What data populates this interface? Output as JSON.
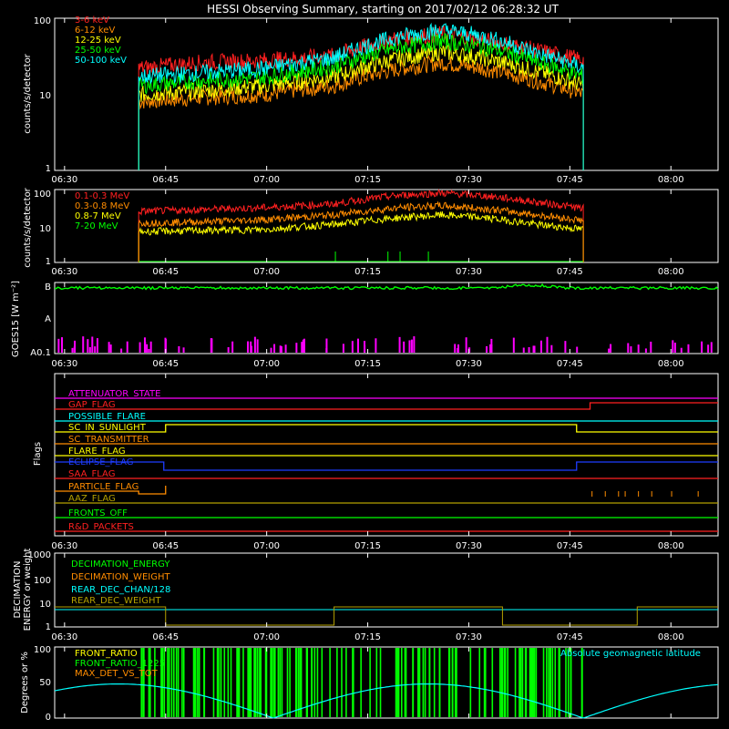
{
  "title": "HESSI Observing Summary, starting on 2017/02/12 06:28:32 UT",
  "colors": {
    "background": "#000000",
    "axes": "#ffffff",
    "red": "#ff2020",
    "orange": "#ff8c00",
    "yellow": "#ffff00",
    "green": "#00ff00",
    "cyan": "#00ffff",
    "magenta": "#ff00ff",
    "blue": "#1e3cff",
    "olive": "#b4a000"
  },
  "x_ticks": [
    "06:30",
    "06:45",
    "07:00",
    "07:15",
    "07:30",
    "07:45",
    "08:00"
  ],
  "chart_data": [
    {
      "type": "line",
      "id": "low-energy-rates",
      "ylabel": "counts/s/detector",
      "yscale": "log",
      "ylim": [
        1,
        100
      ],
      "y_ticks": [
        "1",
        "10",
        "100"
      ],
      "x_range": [
        "06:28:32",
        "08:07"
      ],
      "series": [
        {
          "name": "3-6 keV",
          "color": "red",
          "x": [
            "06:41",
            "06:50",
            "07:00",
            "07:10",
            "07:20",
            "07:26",
            "07:32",
            "07:40",
            "07:47"
          ],
          "values": [
            22,
            26,
            28,
            32,
            55,
            62,
            52,
            38,
            28
          ]
        },
        {
          "name": "6-12 keV",
          "color": "orange",
          "x": [
            "06:41",
            "06:50",
            "07:00",
            "07:10",
            "07:20",
            "07:26",
            "07:32",
            "07:40",
            "07:47"
          ],
          "values": [
            8,
            9,
            10,
            13,
            22,
            26,
            22,
            15,
            10
          ]
        },
        {
          "name": "12-25 keV",
          "color": "yellow",
          "x": [
            "06:41",
            "06:50",
            "07:00",
            "07:10",
            "07:20",
            "07:26",
            "07:32",
            "07:40",
            "07:47"
          ],
          "values": [
            10,
            11,
            13,
            17,
            30,
            36,
            30,
            20,
            13
          ]
        },
        {
          "name": "25-50 keV",
          "color": "green",
          "x": [
            "06:41",
            "06:50",
            "07:00",
            "07:10",
            "07:20",
            "07:26",
            "07:32",
            "07:40",
            "07:47"
          ],
          "values": [
            13,
            15,
            17,
            23,
            42,
            50,
            42,
            27,
            17
          ]
        },
        {
          "name": "50-100 keV",
          "color": "cyan",
          "x": [
            "06:41",
            "06:50",
            "07:00",
            "07:10",
            "07:20",
            "07:26",
            "07:32",
            "07:40",
            "07:47"
          ],
          "values": [
            17,
            19,
            22,
            30,
            58,
            70,
            58,
            35,
            22
          ]
        }
      ]
    },
    {
      "type": "line",
      "id": "high-energy-rates",
      "ylabel": "counts/s/detector",
      "yscale": "log",
      "ylim": [
        1,
        100
      ],
      "y_ticks": [
        "1",
        "10",
        "100"
      ],
      "series": [
        {
          "name": "0.1-0.3 MeV",
          "color": "red",
          "x": [
            "06:41",
            "06:50",
            "07:00",
            "07:10",
            "07:20",
            "07:26",
            "07:32",
            "07:40",
            "07:47"
          ],
          "values": [
            25,
            28,
            32,
            40,
            70,
            80,
            68,
            45,
            30
          ]
        },
        {
          "name": "0.3-0.8 MeV",
          "color": "orange",
          "x": [
            "06:41",
            "06:50",
            "07:00",
            "07:10",
            "07:20",
            "07:26",
            "07:32",
            "07:40",
            "07:47"
          ],
          "values": [
            12,
            13,
            15,
            20,
            32,
            36,
            30,
            20,
            14
          ]
        },
        {
          "name": "0.8-7 MeV",
          "color": "yellow",
          "x": [
            "06:41",
            "06:50",
            "07:00",
            "07:10",
            "07:20",
            "07:26",
            "07:32",
            "07:40",
            "07:47"
          ],
          "values": [
            7,
            7.5,
            8,
            11,
            17,
            20,
            17,
            11,
            8
          ]
        },
        {
          "name": "7-20 MeV",
          "color": "green",
          "x": [
            "06:41",
            "07:47"
          ],
          "values": [
            1,
            1
          ]
        }
      ]
    },
    {
      "type": "line",
      "id": "goes",
      "ylabel": "GOES15 [W m⁻²]",
      "y_ticks": [
        "A0.1",
        "A",
        "B"
      ],
      "series": [
        {
          "name": "GOES15",
          "color": "green",
          "x": [
            "06:30",
            "07:00",
            "07:30",
            "07:38",
            "07:46",
            "08:07"
          ],
          "values": [
            "B",
            "B",
            "B",
            "B+",
            "B",
            "B"
          ]
        }
      ]
    },
    {
      "type": "table",
      "id": "flags",
      "ylabel": "Flags",
      "rows": [
        {
          "name": "ATTENUATOR_STATE",
          "color": "magenta"
        },
        {
          "name": "GAP_FLAG",
          "color": "red"
        },
        {
          "name": "POSSIBLE_FLARE",
          "color": "cyan"
        },
        {
          "name": "SC_IN_SUNLIGHT",
          "color": "yellow"
        },
        {
          "name": "SC_TRANSMITTER",
          "color": "orange"
        },
        {
          "name": "FLARE_FLAG",
          "color": "yellow"
        },
        {
          "name": "ECLIPSE_FLAG",
          "color": "blue"
        },
        {
          "name": "SAA_FLAG",
          "color": "red"
        },
        {
          "name": "PARTICLE_FLAG",
          "color": "orange"
        },
        {
          "name": "AAZ_FLAG",
          "color": "olive"
        },
        {
          "name": "FRONTS_OFF",
          "color": "green"
        },
        {
          "name": "R&D_PACKETS",
          "color": "red"
        }
      ]
    },
    {
      "type": "line",
      "id": "decimation",
      "ylabel": "DECIMATION ENERGY or weight",
      "yscale": "log",
      "ylim": [
        1,
        1000
      ],
      "y_ticks": [
        "1",
        "10",
        "100",
        "1000"
      ],
      "series": [
        {
          "name": "DECIMATION_ENERGY",
          "color": "green"
        },
        {
          "name": "DECIMATION_WEIGHT",
          "color": "orange"
        },
        {
          "name": "REAR_DEC_CHAN/128",
          "color": "cyan"
        },
        {
          "name": "REAR_DEC_WEIGHT",
          "color": "olive"
        }
      ]
    },
    {
      "type": "line",
      "id": "ratios",
      "ylabel": "Degrees or %",
      "ylim": [
        0,
        100
      ],
      "y_ticks": [
        "0",
        "50",
        "100"
      ],
      "annotation": "Absolute geomagnetic latitude",
      "series": [
        {
          "name": "FRONT_RATIO",
          "color": "yellow"
        },
        {
          "name": "FRONT_RATIO_1225",
          "color": "green"
        },
        {
          "name": "MAX_DET_VS_TOT",
          "color": "orange"
        }
      ]
    }
  ]
}
